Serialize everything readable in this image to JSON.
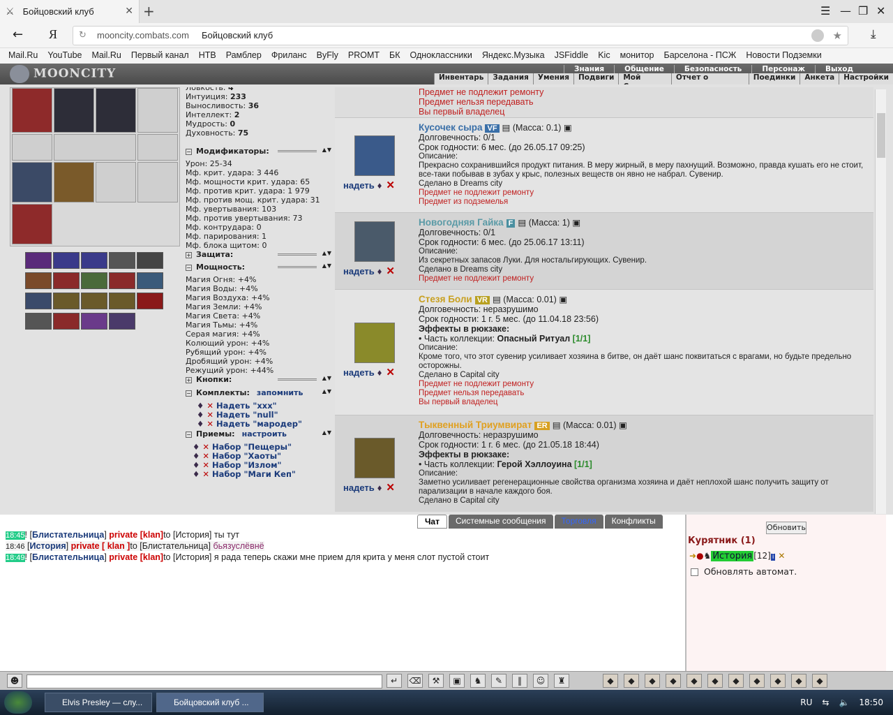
{
  "browser": {
    "tab_title": "Бойцовский клуб",
    "tab_close": "✕",
    "new_tab": "+",
    "back": "←",
    "yandex_logo": "Я",
    "url_domain": "mooncity.combats.com",
    "url_title": "Бойцовский клуб",
    "menu": "☰",
    "minimize": "—",
    "restore": "❐",
    "close": "✕",
    "download": "⤓",
    "star": "★"
  },
  "bookmarks": [
    "Mail.Ru",
    "YouTube",
    "Mail.Ru",
    "Первый канал",
    "НТВ",
    "Рамблер",
    "Фриланс",
    "ByFly",
    "PROMT",
    "БК",
    "Одноклассники",
    "Яндекс.Музыка",
    "JSFiddle",
    "Kic",
    "монитор",
    "Барселона - ПСЖ",
    "Новости Подземки"
  ],
  "game": {
    "logo": "MOONCITY",
    "top_menu": [
      "Знания",
      "Общение",
      "Безопасность",
      "Персонаж",
      "Выход"
    ],
    "sub_menu": [
      "Инвентарь",
      "Задания",
      "Умения",
      "Подвиги",
      "Мой Скролл",
      "Отчет о переводах",
      "Поединки",
      "Анкета",
      "Настройки"
    ]
  },
  "stats": {
    "base": [
      {
        "label": "Ловкость:",
        "value": "4"
      },
      {
        "label": "Интуиция:",
        "value": "233"
      },
      {
        "label": "Выносливость:",
        "value": "36"
      },
      {
        "label": "Интеллект:",
        "value": "2"
      },
      {
        "label": "Мудрость:",
        "value": "0"
      },
      {
        "label": "Духовность:",
        "value": "75"
      }
    ],
    "mod_title": "Модификаторы:",
    "mods": [
      "Урон: 25-34",
      "Мф. крит. удара: 3 446",
      "Мф. мощности крит. удара: 65",
      "Мф. против крит. удара: 1 979",
      "Мф. против мощ. крит. удара: 31",
      "Мф. увертывания: 103",
      "Мф. против увертывания: 73",
      "Мф. контрудара: 0",
      "Мф. парирования: 1",
      "Мф. блока щитом: 0"
    ],
    "protection_title": "Защита:",
    "power_title": "Мощность:",
    "power": [
      "Магия Огня: +4%",
      "Магия Воды: +4%",
      "Магия Воздуха: +4%",
      "Магия Земли: +4%",
      "Магия Света: +4%",
      "Магия Тьмы: +4%",
      "Серая магия: +4%",
      "Колющий урон: +4%",
      "Рубящий урон: +4%",
      "Дробящий урон: +4%",
      "Режущий урон: +44%"
    ],
    "buttons_title": "Кнопки:",
    "kits_title": "Комплекты:",
    "kits_remember": "запомнить",
    "kits": [
      "Надеть \"xxx\"",
      "Надеть \"null\"",
      "Надеть \"мародер\""
    ],
    "tricks_title": "Приемы:",
    "tricks_setup": "настроить",
    "tricks": [
      "Набор \"Пещеры\"",
      "Набор \"Хаоты\"",
      "Набор \"Излом\"",
      "Набор \"Маги Кеп\""
    ]
  },
  "inventory": {
    "wear_label": "надеть",
    "top_lines": [
      "Предмет не подлежит ремонту",
      "Предмет нельзя передавать",
      "Вы первый владелец"
    ],
    "items": [
      {
        "name": "Кусочек сыра",
        "badge": "VF",
        "badge_color": "#3a6fa8",
        "name_color": "#3a6fa8",
        "mass": "(Масса: 0.1)",
        "durability": "Долговечность: 0/1",
        "expiry": "Срок годности: 6 мес. (до 26.05.17 09:25)",
        "desc_title": "Описание:",
        "desc": "Прекрасно сохранившийся продукт питания. В меру жирный, в меру пахнущий. Возможно, правда кушать его не стоит, все-таки побывав в зубах у крыс, полезных веществ он явно не набрал. Сувенир.",
        "made": "Сделано в Dreams city",
        "notes": [
          "Предмет не подлежит ремонту",
          "Предмет из подземелья"
        ]
      },
      {
        "name": "Новогодняя Гайка",
        "badge": "F",
        "badge_color": "#4a8fa0",
        "name_color": "#5a9aa6",
        "mass": "(Масса: 1)",
        "durability": "Долговечность: 0/1",
        "expiry": "Срок годности: 6 мес. (до 25.06.17 13:11)",
        "desc_title": "Описание:",
        "desc": "Из секретных запасов Луки. Для ностальгирующих. Сувенир.",
        "made": "Сделано в Dreams city",
        "notes": [
          "Предмет не подлежит ремонту"
        ]
      },
      {
        "name": "Стезя Боли",
        "badge": "VR",
        "badge_color": "#b8a020",
        "name_color": "#c8a020",
        "mass": "(Масса: 0.01)",
        "durability": "Долговечность: неразрушимо",
        "expiry": "Срок годности: 1 г. 5 мес. (до 11.04.18 23:56)",
        "effects": "Эффекты в рюкзаке:",
        "collection_prefix": "• Часть коллекции: ",
        "collection": "Опасный Ритуал",
        "collection_count": "[1/1]",
        "desc_title": "Описание:",
        "desc": "Кроме того, что этот сувенир усиливает хозяина в битве, он даёт шанс поквитаться с врагами, но будьте предельно осторожны.",
        "made": "Сделано в Capital city",
        "notes": [
          "Предмет не подлежит ремонту",
          "Предмет нельзя передавать",
          "Вы первый владелец"
        ]
      },
      {
        "name": "Тыквенный Триумвират",
        "badge": "ER",
        "badge_color": "#d8a020",
        "name_color": "#e0a020",
        "mass": "(Масса: 0.01)",
        "durability": "Долговечность: неразрушимо",
        "expiry": "Срок годности: 1 г. 6 мес. (до 21.05.18 18:44)",
        "effects": "Эффекты в рюкзаке:",
        "collection_prefix": "• Часть коллекции: ",
        "collection": "Герой Хэллоуина",
        "collection_count": "[1/1]",
        "desc_title": "Описание:",
        "desc": "Заметно усиливает регенерационные свойства организма хозяина и даёт неплохой шанс получить защиту от парализации в начале каждого боя.",
        "made": "Сделано в Capital city",
        "notes": []
      }
    ]
  },
  "chat": {
    "tabs": [
      "Чат",
      "Системные сообщения",
      "Торговля",
      "Конфликты"
    ],
    "messages": [
      {
        "time": "18:45",
        "from": "Блистательница",
        "type": "private [klan]",
        "to": "to [История]",
        "text": "ты тут"
      },
      {
        "time": "18:46",
        "from": "История",
        "type": "private [ klan ]",
        "to": "to [Блистательница]",
        "text": "бьязуслёвнё"
      },
      {
        "time": "18:49",
        "from": "Блистательница",
        "type": "private [klan]",
        "to": "to [История]",
        "text": "я рада теперь скажи мне прием для крита у меня слот пустой стоит"
      }
    ]
  },
  "users": {
    "refresh": "Обновить",
    "room": "Курятник (1)",
    "user_name": "История",
    "user_level": "[12]",
    "auto_update": "Обновлять автомат."
  },
  "taskbar": {
    "tasks": [
      "Elvis Presley — слу...",
      "Бойцовский клуб ..."
    ],
    "lang": "RU",
    "clock": "18:50"
  }
}
